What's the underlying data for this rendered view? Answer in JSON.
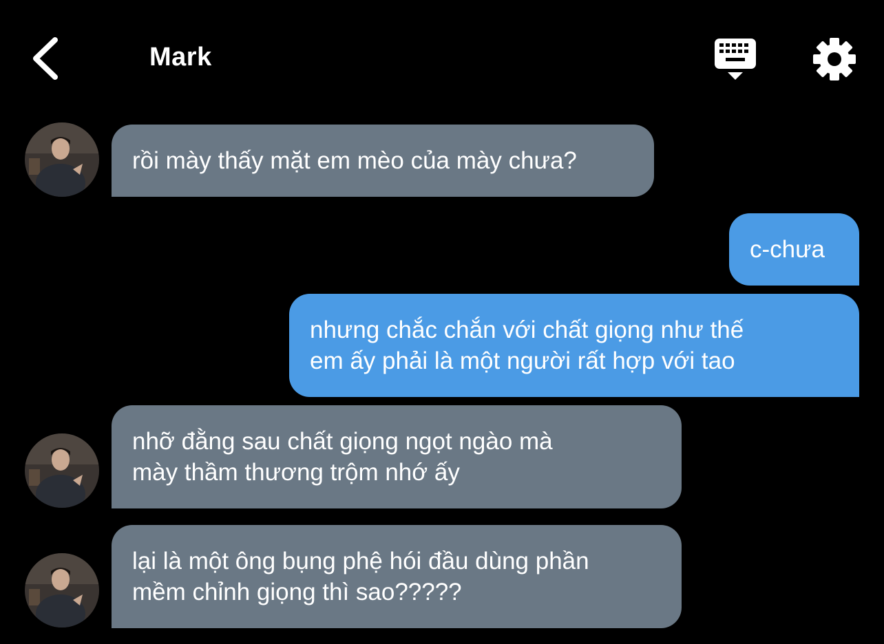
{
  "header": {
    "title": "Mark",
    "back_icon": "chevron-left-icon",
    "keyboard_icon": "keyboard-dismiss-icon",
    "settings_icon": "gear-icon"
  },
  "colors": {
    "background": "#000000",
    "incoming_bubble": "#6a7885",
    "outgoing_bubble": "#4b9be5",
    "text": "#ffffff"
  },
  "messages": [
    {
      "sender": "contact",
      "text": "rồi mày thấy mặt em mèo của mày chưa?"
    },
    {
      "sender": "me",
      "text": "c-chưa"
    },
    {
      "sender": "me",
      "text": "nhưng chắc chắn với chất giọng như thế\nem ấy phải là một người rất hợp với tao"
    },
    {
      "sender": "contact",
      "text": "nhỡ đằng sau chất giọng ngọt ngào mà\nmày thầm thương trộm nhớ ấy"
    },
    {
      "sender": "contact",
      "text": "lại là một ông bụng phệ hói đầu dùng phần\nmềm chỉnh giọng thì sao?????"
    }
  ]
}
